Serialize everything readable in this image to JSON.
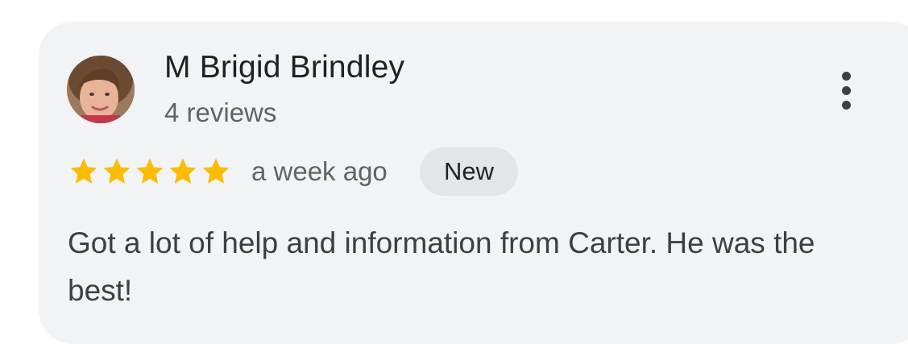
{
  "review": {
    "reviewer_name": "M Brigid Brindley",
    "review_count": "4 reviews",
    "rating": 5,
    "rating_max": 5,
    "timestamp": "a week ago",
    "badge": "New",
    "text": "Got a lot of help and information from Carter. He was the best!"
  },
  "icons": {
    "more": "more-vert-icon",
    "star": "star-icon",
    "avatar": "reviewer-avatar"
  },
  "colors": {
    "card_background": "#f2f3f5",
    "star": "#fbbc04",
    "badge_background": "#e3e5e8",
    "primary_text": "#202124",
    "secondary_text": "#5f6368"
  }
}
